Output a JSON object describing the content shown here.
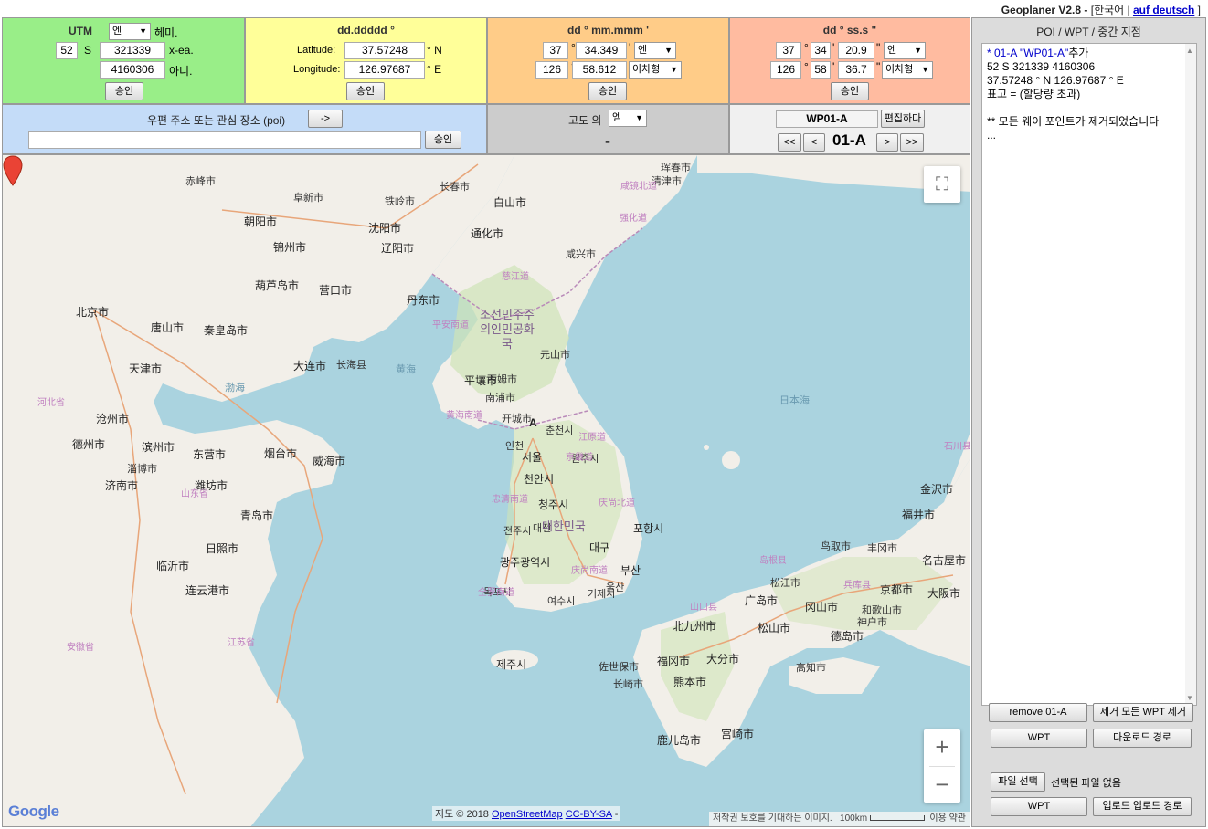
{
  "app": {
    "title": "Geoplaner V2.8 - ",
    "lang_current": "[한국어 | ",
    "lang_link": "auf deutsch",
    "lang_close": " ]"
  },
  "utm": {
    "header": "UTM",
    "zone": "52",
    "band": "S",
    "easting": "321339",
    "northing": "4160306",
    "datum": "엔",
    "east_label": "헤미.",
    "easting_label": "x-ea.",
    "northing_label": "아니.",
    "submit": "승인"
  },
  "dd": {
    "header": "dd.ddddd °",
    "lat_label": "Latitude:",
    "lat": "37.57248",
    "lat_hem": "° N",
    "lon_label": "Longitude:",
    "lon": "126.97687",
    "lon_hem": "° E",
    "submit": "승인"
  },
  "ddm": {
    "header": "dd ° mm.mmm '",
    "lat_deg": "37",
    "lat_min": "34.349",
    "lat_hem": "엔",
    "lon_deg": "126",
    "lon_min": "58.612",
    "lon_hem": "이차형",
    "submit": "승인"
  },
  "dms": {
    "header": "dd ° ss.s \"",
    "lat_deg": "37",
    "lat_min": "34",
    "lat_sec": "20.9",
    "lat_hem": "엔",
    "lon_deg": "126",
    "lon_min": "58",
    "lon_sec": "36.7",
    "lon_hem": "이차형",
    "submit": "승인"
  },
  "search": {
    "label": "우편 주소 또는 관심 장소 (poi)",
    "arrow": "->",
    "value": "",
    "submit": "승인"
  },
  "altitude": {
    "label": "고도 의",
    "unit": "엠",
    "value": "-"
  },
  "waypoint": {
    "name": "WP01-A",
    "edit": "편집하다",
    "current": "01-A",
    "first": "<<",
    "prev": "<",
    "next": ">",
    "last": ">>"
  },
  "map": {
    "fullscreen": "⛶",
    "zoom_in": "+",
    "zoom_out": "−",
    "marker_label": "A",
    "google": "Google",
    "attribution_prefix": "지도 © 2018 ",
    "attribution_osm": "OpenStreetMap",
    "attribution_lic": "CC-BY-SA",
    "attribution_suffix": " -",
    "copyright_note": "저작권 보호를 기대하는 이미지.",
    "scale": "100km",
    "terms": "이용 약관",
    "labels": [
      "赤峰市",
      "阜新市",
      "铁岭市",
      "长春市",
      "通化市",
      "白山市",
      "珲春市",
      "沈阳市",
      "辽阳市",
      "朝阳市",
      "锦州市",
      "葫芦岛市",
      "营口市",
      "丹东市",
      "大连市",
      "长海县",
      "北京市",
      "天津市",
      "唐山市",
      "秦皇岛市",
      "沧州市",
      "德州市",
      "滨州市",
      "东营市",
      "烟台市",
      "威海市",
      "济南市",
      "淄博市",
      "潍坊市",
      "青岛市",
      "临沂市",
      "日照市",
      "连云港市",
      "平壤市",
      "元山市",
      "咸兴市",
      "清津市",
      "开城市",
      "南浦市",
      "西姆市",
      "서울",
      "인천",
      "춘천시",
      "원주시",
      "천안시",
      "청주시",
      "대전",
      "대구",
      "포항시",
      "울산",
      "부산",
      "광주광역시",
      "목포시",
      "여수시",
      "전주시",
      "제주시",
      "거제시",
      "福冈市",
      "北九州市",
      "熊本市",
      "大分市",
      "宫崎市",
      "鹿儿岛市",
      "长崎市",
      "佐世保市",
      "广岛市",
      "松山市",
      "冈山市",
      "德岛市",
      "高知市",
      "松江市",
      "鸟取市",
      "丰冈市",
      "京都市",
      "大阪市",
      "神户市",
      "和歌山市",
      "名古屋市",
      "金沢市",
      "福井市",
      "조선민주주의인민공화국",
      "대한민국",
      "渤海",
      "黄海",
      "日本海",
      "强化道",
      "江苏省",
      "山东省",
      "河北省",
      "安徽省",
      "江原道",
      "京畿道",
      "忠清南道",
      "全罗南道",
      "庆尚南道",
      "庆尚北道",
      "咸镜北道",
      "慈江道",
      "平安南道",
      "黄海南道",
      "岛根县",
      "山口县",
      "兵库县",
      "石川县"
    ]
  },
  "side": {
    "header": "POI / WPT / 중간 지점",
    "log_link": "* 01-A \"WP01-A\"",
    "log_link_suffix": "추가",
    "log_line1": "52 S 321339 4160306",
    "log_line2": "37.57248 ° N 126.97687 ° E",
    "log_line3": "표고 = (할당량 초과)",
    "log_line4": "** 모든 웨이 포인트가 제거되었습니다",
    "log_line5": "...",
    "remove": "remove 01-A",
    "remove_all": "제거 모든 WPT 제거",
    "wpt1": "WPT",
    "download": "다운로드 경로",
    "file_choose": "파일 선택",
    "file_none": "선택된 파일 없음",
    "wpt2": "WPT",
    "upload": "업로드 업로드 경로"
  }
}
